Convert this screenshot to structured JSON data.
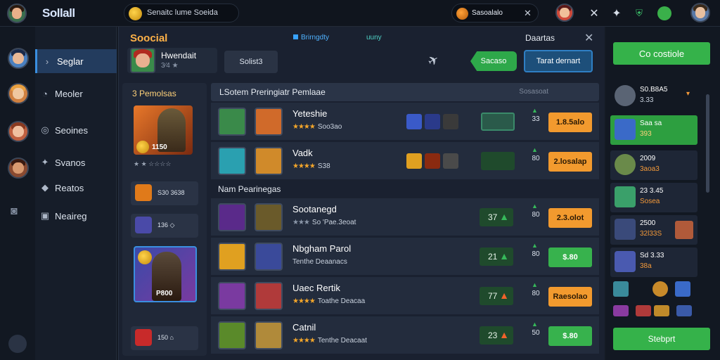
{
  "topbar": {
    "brand": "Sollall",
    "search_text": "Senaitc lume Soeida",
    "currency_value": "Sasoalalo",
    "currency_close": "✕",
    "icons": [
      "avatar-icon",
      "coin-icon",
      "notification-avatar-icon",
      "close-icon",
      "settings-icon",
      "shield-icon",
      "status-icon",
      "profile-avatar-icon"
    ]
  },
  "leftnav": {
    "items": [
      {
        "label": "Seglar",
        "icon": "chevron-right-icon",
        "active": true
      },
      {
        "label": "Meoler",
        "icon": "chat-icon",
        "active": false
      },
      {
        "label": "Seoines",
        "icon": "friends-icon",
        "active": false
      },
      {
        "label": "Svanos",
        "icon": "group-icon",
        "active": false
      },
      {
        "label": "Reatos",
        "icon": "tag-icon",
        "active": false
      },
      {
        "label": "Neaireg",
        "icon": "grid-icon",
        "active": false
      }
    ]
  },
  "main": {
    "title": "Soocial",
    "tabs": [
      "Brirngdty",
      "uuny"
    ],
    "right_tab": "Daartas",
    "close": "✕",
    "profile": {
      "name": "Hwendait",
      "rating": "3⁄4 ★"
    },
    "profile_button": "Solist3",
    "green_pill": "Sacaso",
    "blue_button": "Tarat dernart",
    "left_col": {
      "header": "3 Pemolsas",
      "feature_1_label": "1150",
      "feature_1_rating": "★ ★ ☆☆☆☆",
      "small_cards": [
        {
          "text": "S30 3638"
        },
        {
          "text": "136 ◇"
        },
        {
          "text": "150 ⌂"
        }
      ],
      "feature_2_label": "P800"
    },
    "table": {
      "header_left": "LSotem Preringiatr Pemlaae",
      "header_right": "Sosasoat",
      "subhead": "Nam Pearinegas",
      "rows": [
        {
          "name": "Yeteshie",
          "stars": "★★★★",
          "meta": "Soo3ao",
          "score": "",
          "mid": "33",
          "action": "1.8.5alo",
          "action_color": "orange"
        },
        {
          "name": "Vadk",
          "stars": "★★★★",
          "meta": "S38",
          "score": "",
          "mid": "80",
          "action": "2.losalap",
          "action_color": "orange"
        },
        {
          "name": "Sootanegd",
          "stars": "★★★",
          "meta": "So 'Pae.3eoat",
          "score": "37",
          "mid": "80",
          "action": "2.3.olot",
          "action_color": "orange"
        },
        {
          "name": "Nbgham Parol",
          "stars": "",
          "meta": "Tenthe Deaanacs",
          "score": "21",
          "mid": "80",
          "action": "$.80",
          "action_color": "green"
        },
        {
          "name": "Uaec Rertik",
          "stars": "★★★★",
          "meta": "Toathe Deacaa",
          "score": "77",
          "mid": "80",
          "action": "Raesolao",
          "action_color": "orange"
        },
        {
          "name": "Catnil",
          "stars": "★★★★",
          "meta": "Tenthe Deacaat",
          "score": "23",
          "mid": "50",
          "action": "$.80",
          "action_color": "green"
        }
      ]
    }
  },
  "rightcol": {
    "connect_button": "Co costiole",
    "items": [
      {
        "t1": "S0.B8A5",
        "t2": "3.33"
      },
      {
        "t1": "Saa sa",
        "t2": "393"
      },
      {
        "t1": "2009",
        "t2": "3aoa3"
      },
      {
        "t1": "23 3.45",
        "t2": "Sosea"
      },
      {
        "t1": "2500",
        "t2": "32l33S"
      },
      {
        "t1": "Sd 3.33",
        "t2": "38a"
      }
    ],
    "search_button": "Stebprt"
  },
  "colors": {
    "accent_orange": "#f29a2e",
    "accent_green": "#37b24d",
    "accent_blue": "#3a8fe0",
    "title_orange": "#ffb248",
    "background": "#141a24"
  }
}
